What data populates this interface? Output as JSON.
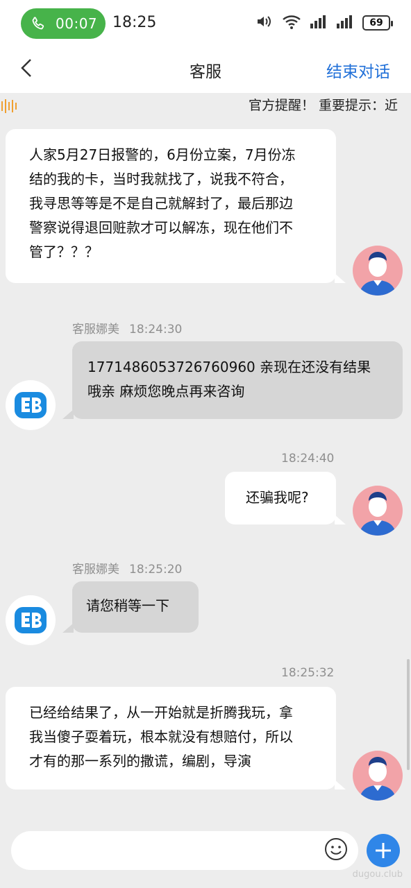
{
  "status_bar": {
    "call_time": "00:07",
    "clock": "18:25",
    "battery": "69",
    "icons": [
      "phone-icon",
      "volume-icon",
      "wifi-icon",
      "signal-icon",
      "signal-icon",
      "battery-icon"
    ]
  },
  "header": {
    "title": "客服",
    "end_button": "结束对话"
  },
  "notice": {
    "text": "官方提醒！ 重要提示：近"
  },
  "messages": [
    {
      "side": "user",
      "lines": [
        "人家5月27日报警的，6月份立案，7月份冻",
        "结的我的卡，当时我就找了，说我不符合，",
        "我寻思等等是不是自己就解封了，最后那边",
        "警察说得退回赃款才可以解冻，现在他们不",
        "管了？？？"
      ]
    },
    {
      "side": "agent",
      "sender": "客服娜美",
      "time": "18:24:30",
      "lines": [
        "1771486053726760960 亲现在还没有结果",
        "哦亲 麻烦您晚点再来咨询"
      ]
    },
    {
      "side": "user",
      "time": "18:24:40",
      "lines": [
        "还骗我呢?"
      ]
    },
    {
      "side": "agent",
      "sender": "客服娜美",
      "time": "18:25:20",
      "lines": [
        "请您稍等一下"
      ]
    },
    {
      "side": "user",
      "time": "18:25:32",
      "lines": [
        "已经给结果了，从一开始就是折腾我玩，拿",
        "我当傻子耍着玩，根本就没有想赔付，所以",
        "才有的那一系列的撒谎，编剧，导演"
      ]
    }
  ],
  "input": {
    "placeholder": ""
  },
  "watermark": "dugou.club",
  "colors": {
    "accent": "#1f6fd8",
    "call_green": "#47b34a",
    "user_avatar_bg": "#f2a3a8",
    "agent_bubble": "#d6d6d6"
  }
}
